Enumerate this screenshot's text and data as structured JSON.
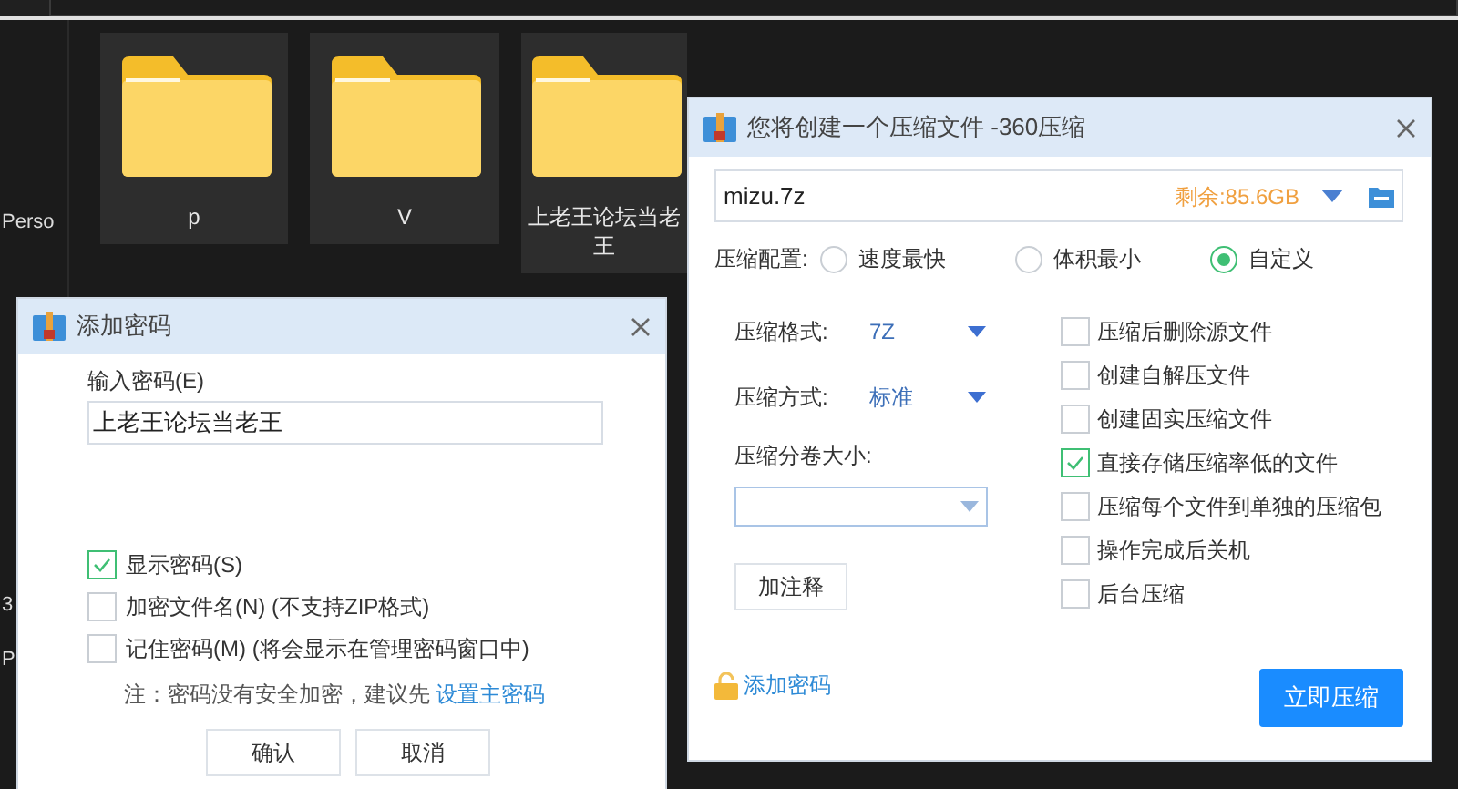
{
  "explorer": {
    "sidebar_items": [
      "Perso",
      "3",
      "P"
    ],
    "folders": [
      {
        "name": "p"
      },
      {
        "name": "V"
      },
      {
        "name": "上老王论坛当老王"
      }
    ]
  },
  "password_dialog": {
    "title": "添加密码",
    "password_label": "输入密码(E)",
    "password_value": "上老王论坛当老王",
    "options": [
      {
        "label": "显示密码(S)",
        "checked": true
      },
      {
        "label": "加密文件名(N) (不支持ZIP格式)",
        "checked": false
      },
      {
        "label": "记住密码(M) (将会显示在管理密码窗口中)",
        "checked": false
      }
    ],
    "note": "注：密码没有安全加密，建议先",
    "note_link": "设置主密码",
    "buttons": [
      "确认",
      "取消"
    ]
  },
  "compress_dialog": {
    "title": "您将创建一个压缩文件 -360压缩",
    "filename": "mizu.7z",
    "free_space": "剩余:85.6GB",
    "profile_label": "压缩配置:",
    "profiles": [
      {
        "label": "速度最快",
        "selected": false
      },
      {
        "label": "体积最小",
        "selected": false
      },
      {
        "label": "自定义",
        "selected": true
      }
    ],
    "format_label": "压缩格式:",
    "format": "7Z",
    "method_label": "压缩方式:",
    "method": "标准",
    "split_label": "压缩分卷大小:",
    "comment_button": "加注释",
    "options": [
      {
        "label": "压缩后删除源文件",
        "checked": false
      },
      {
        "label": "创建自解压文件",
        "checked": false
      },
      {
        "label": "创建固实压缩文件",
        "checked": false
      },
      {
        "label": "直接存储压缩率低的文件",
        "checked": true
      },
      {
        "label": "压缩每个文件到单独的压缩包",
        "checked": false
      },
      {
        "label": "操作完成后关机",
        "checked": false
      },
      {
        "label": "后台压缩",
        "checked": false
      }
    ],
    "add_password": "添加密码",
    "start_button": "立即压缩"
  }
}
